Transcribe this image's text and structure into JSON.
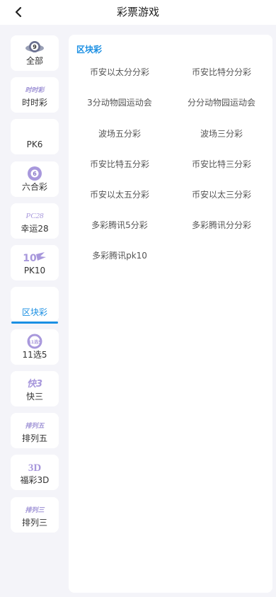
{
  "header": {
    "title": "彩票游戏",
    "back_icon": "chevron-left-icon"
  },
  "sidebar": {
    "items": [
      {
        "label": "全部",
        "icon": "ball-9-icon",
        "badge": "9"
      },
      {
        "label": "时时彩",
        "icon": "ssc-logo-icon",
        "logo_text": "时时彩"
      },
      {
        "label": "PK6",
        "icon": ""
      },
      {
        "label": "六合彩",
        "icon": "lhc-ball-icon",
        "badge": "6"
      },
      {
        "label": "幸运28",
        "icon": "pc28-logo-icon",
        "logo_text": "PC28"
      },
      {
        "label": "PK10",
        "icon": "pk10-logo-icon",
        "logo_text": "10"
      },
      {
        "label": "区块彩",
        "icon": "",
        "active": true
      },
      {
        "label": "11选5",
        "icon": "11x5-logo-icon",
        "logo_text": "11选5"
      },
      {
        "label": "快三",
        "icon": "k3-logo-icon",
        "logo_text": "快3"
      },
      {
        "label": "排列五",
        "icon": "pl5-logo-icon",
        "logo_text": "排列五"
      },
      {
        "label": "福彩3D",
        "icon": "3d-logo-icon",
        "logo_text": "3D"
      },
      {
        "label": "排列三",
        "icon": "pl3-logo-icon",
        "logo_text": "排列三"
      }
    ]
  },
  "content": {
    "section_title": "区块彩",
    "games": [
      "币安以太分分彩",
      "币安比特分分彩",
      "3分动物园运动会",
      "分分动物园运动会",
      "波场五分彩",
      "波场三分彩",
      "币安比特五分彩",
      "币安比特三分彩",
      "币安以太五分彩",
      "币安以太三分彩",
      "多彩腾讯5分彩",
      "多彩腾讯分分彩",
      "多彩腾讯pk10"
    ]
  },
  "colors": {
    "accent": "#1a8fe3",
    "icon": "#9f93d6",
    "background": "#f4f4f9"
  }
}
